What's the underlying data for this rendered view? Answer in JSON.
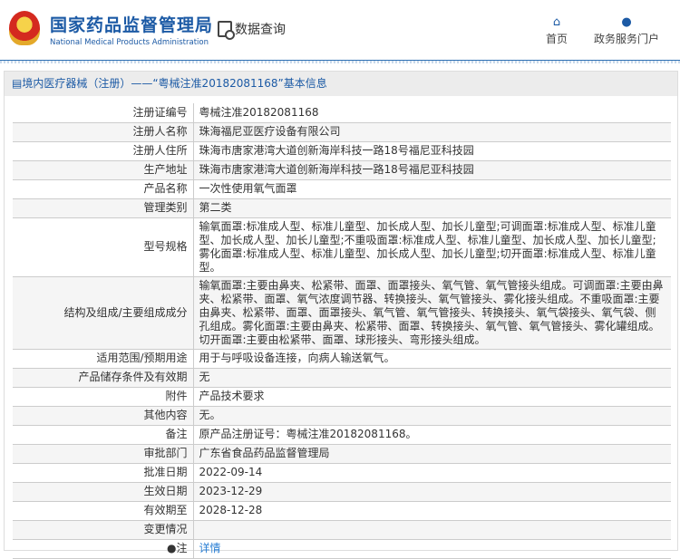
{
  "header": {
    "title_cn": "国家药品监督管理局",
    "title_en": "National Medical Products Administration",
    "query": "数据查询",
    "nav": [
      {
        "label": "首页",
        "icon": "home-icon"
      },
      {
        "label": "政务服务门户",
        "icon": "user-icon"
      }
    ]
  },
  "breadcrumb": "境内医疗器械（注册）——“粤械注准20182081168”基本信息",
  "rows": [
    {
      "label": "注册证编号",
      "value": "粤械注准20182081168"
    },
    {
      "label": "注册人名称",
      "value": "珠海福尼亚医疗设备有限公司"
    },
    {
      "label": "注册人住所",
      "value": "珠海市唐家港湾大道创新海岸科技一路18号福尼亚科技园"
    },
    {
      "label": "生产地址",
      "value": "珠海市唐家港湾大道创新海岸科技一路18号福尼亚科技园"
    },
    {
      "label": "产品名称",
      "value": "一次性使用氧气面罩"
    },
    {
      "label": "管理类别",
      "value": "第二类"
    },
    {
      "label": "型号规格",
      "value": "输氧面罩:标准成人型、标准儿童型、加长成人型、加长儿童型;可调面罩:标准成人型、标准儿童型、加长成人型、加长儿童型;不重吸面罩:标准成人型、标准儿童型、加长成人型、加长儿童型;雾化面罩:标准成人型、标准儿童型、加长成人型、加长儿童型;切开面罩:标准成人型、标准儿童型。"
    },
    {
      "label": "结构及组成/主要组成成分",
      "value": "输氧面罩:主要由鼻夹、松紧带、面罩、面罩接头、氧气管、氧气管接头组成。可调面罩:主要由鼻夹、松紧带、面罩、氧气浓度调节器、转换接头、氧气管接头、雾化接头组成。不重吸面罩:主要由鼻夹、松紧带、面罩、面罩接头、氧气管、氧气管接头、转换接头、氧气袋接头、氧气袋、侧孔组成。雾化面罩:主要由鼻夹、松紧带、面罩、转换接头、氧气管、氧气管接头、雾化罐组成。切开面罩:主要由松紧带、面罩、球形接头、弯形接头组成。"
    },
    {
      "label": "适用范围/预期用途",
      "value": "用于与呼吸设备连接，向病人输送氧气。"
    },
    {
      "label": "产品储存条件及有效期",
      "value": "无"
    },
    {
      "label": "附件",
      "value": "产品技术要求"
    },
    {
      "label": "其他内容",
      "value": "无。"
    },
    {
      "label": "备注",
      "value": "原产品注册证号：粤械注准20182081168。"
    },
    {
      "label": "审批部门",
      "value": "广东省食品药品监督管理局"
    },
    {
      "label": "批准日期",
      "value": "2022-09-14"
    },
    {
      "label": "生效日期",
      "value": "2023-12-29"
    },
    {
      "label": "有效期至",
      "value": "2028-12-28"
    },
    {
      "label": "变更情况",
      "value": ""
    }
  ],
  "note": {
    "label": "注",
    "link": "详情"
  }
}
